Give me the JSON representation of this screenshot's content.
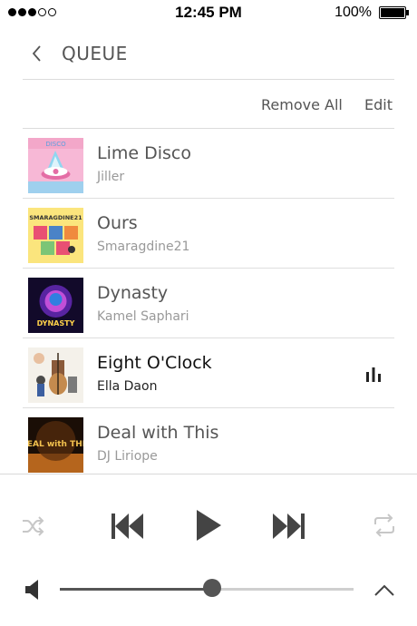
{
  "status": {
    "time": "12:45 PM",
    "battery": "100%",
    "signal_full": 3,
    "signal_empty": 2
  },
  "header": {
    "title": "QUEUE",
    "back_icon": "chevron-left-icon"
  },
  "toolbar": {
    "remove_all": "Remove All",
    "edit": "Edit"
  },
  "queue": [
    {
      "song": "Lime Disco",
      "artist": "Jiller",
      "art": "DISCO",
      "playing": false
    },
    {
      "song": "Ours",
      "artist": "Smaragdine21",
      "art": "SMARAGDINE21",
      "playing": false
    },
    {
      "song": "Dynasty",
      "artist": "Kamel Saphari",
      "art": "DYNASTY",
      "playing": false
    },
    {
      "song": "Eight O'Clock",
      "artist": "Ella Daon",
      "art": "",
      "playing": true
    },
    {
      "song": "Deal with This",
      "artist": "DJ Liriope",
      "art": "DEAL with THIS",
      "playing": false
    }
  ],
  "player": {
    "volume": 0.52,
    "accent": "#555555"
  }
}
